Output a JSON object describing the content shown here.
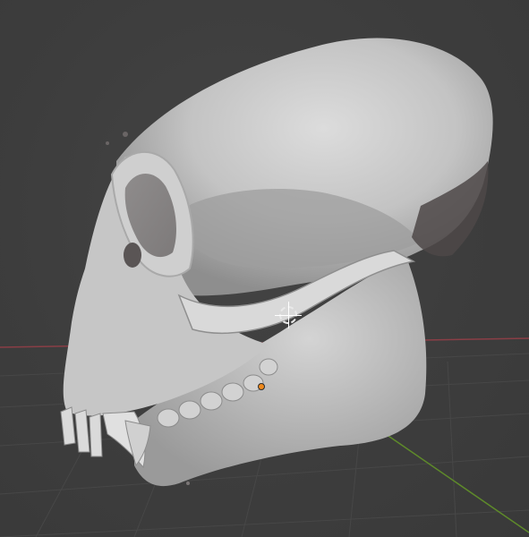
{
  "viewport": {
    "mode": "3D viewport",
    "object": "skull-mesh",
    "colors": {
      "background": "#3d3d3d",
      "grid_line": "#474747",
      "x_axis": "#8a3e46",
      "y_axis": "#5e8a2a",
      "mesh": "#c8c8c8",
      "origin": "#f08a1c"
    }
  },
  "icons": {
    "cursor": "3d-cursor-icon",
    "origin": "object-origin-icon"
  }
}
